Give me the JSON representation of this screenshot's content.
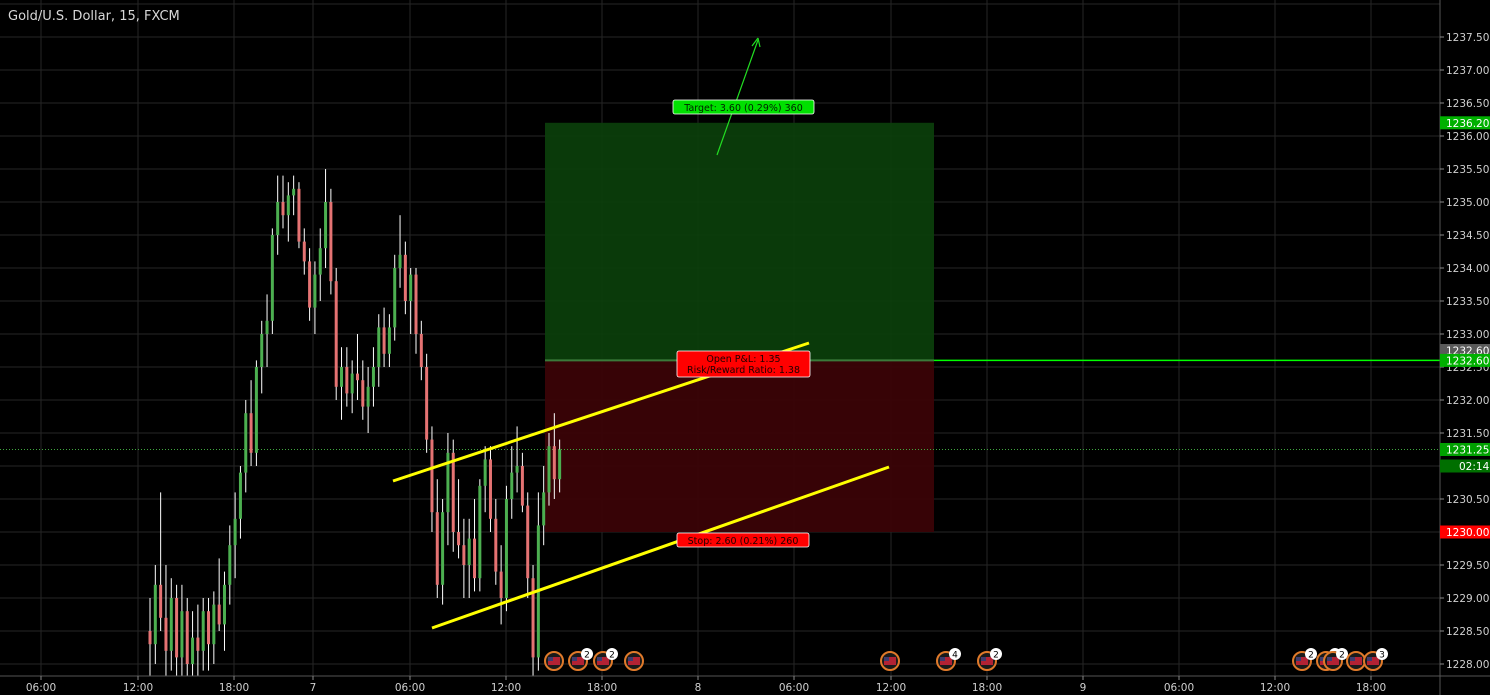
{
  "header": {
    "title": "Gold/U.S. Dollar, 15, FXCM"
  },
  "colors": {
    "background": "#000000",
    "grid": "#262626",
    "up_candle": "#4caf50",
    "down_candle": "#e57373",
    "wick": "#ffffff",
    "channel_line": "#ffff00",
    "target_zone": "#0b3d0b",
    "stop_zone": "#3a0306",
    "entry_line": "#00ff00",
    "target_label": "#00e000",
    "stop_label": "#ff0000",
    "price_tag_current": "#00a000",
    "price_tag_last": "#5a5a5a"
  },
  "chart_data": {
    "type": "candlestick",
    "symbol": "Gold/U.S. Dollar",
    "interval": "15",
    "source": "FXCM",
    "ylim": [
      1227.8,
      1238.2
    ],
    "y_ticks": [
      "1228.00",
      "1228.50",
      "1229.00",
      "1229.50",
      "1230.50",
      "1231.00",
      "1231.50",
      "1232.00",
      "1232.50",
      "1233.00",
      "1233.50",
      "1234.00",
      "1234.50",
      "1235.00",
      "1235.50",
      "1236.00",
      "1236.50",
      "1237.00",
      "1237.50"
    ],
    "x_ticks": [
      "06:00",
      "12:00",
      "18:00",
      "7",
      "06:00",
      "12:00",
      "18:00",
      "8",
      "06:00",
      "12:00",
      "18:00",
      "9",
      "06:00",
      "12:00",
      "18:00"
    ],
    "price_tags": [
      {
        "label": "1236.20",
        "value": 1236.2,
        "kind": "target"
      },
      {
        "label": "1232.60",
        "value": 1232.75,
        "kind": "last"
      },
      {
        "label": "1232.60",
        "value": 1232.6,
        "kind": "entry"
      },
      {
        "label": "1231.25",
        "value": 1231.25,
        "kind": "current"
      },
      {
        "label": "02:14",
        "value": 1231.0,
        "kind": "countdown"
      },
      {
        "label": "1230.00",
        "value": 1230.0,
        "kind": "stop"
      }
    ],
    "position": {
      "entry": 1232.6,
      "target": 1236.2,
      "stop": 1230.0,
      "target_label": "Target: 3.60 (0.29%) 360",
      "stop_label": "Stop: 2.60 (0.21%) 260",
      "pnl_label_line1": "Open P&L: 1.35",
      "pnl_label_line2": "Risk/Reward Ratio: 1.38"
    },
    "candles": [
      [
        1228.5,
        1229.0,
        1227.8,
        1228.3
      ],
      [
        1228.3,
        1229.5,
        1228.0,
        1229.2
      ],
      [
        1229.2,
        1230.6,
        1228.5,
        1228.7
      ],
      [
        1228.7,
        1229.5,
        1227.8,
        1228.2
      ],
      [
        1228.2,
        1229.3,
        1227.9,
        1229.0
      ],
      [
        1229.0,
        1229.2,
        1227.8,
        1228.1
      ],
      [
        1228.1,
        1229.2,
        1227.8,
        1228.8
      ],
      [
        1228.8,
        1229.0,
        1227.8,
        1228.0
      ],
      [
        1228.0,
        1228.8,
        1227.8,
        1228.4
      ],
      [
        1228.4,
        1228.9,
        1227.8,
        1228.2
      ],
      [
        1228.2,
        1229.0,
        1227.9,
        1228.8
      ],
      [
        1228.8,
        1229.0,
        1227.9,
        1228.3
      ],
      [
        1228.3,
        1229.1,
        1228.0,
        1228.9
      ],
      [
        1228.9,
        1229.6,
        1228.5,
        1228.6
      ],
      [
        1228.6,
        1229.4,
        1228.2,
        1229.2
      ],
      [
        1229.2,
        1230.1,
        1228.9,
        1229.8
      ],
      [
        1229.8,
        1230.6,
        1229.3,
        1230.2
      ],
      [
        1230.2,
        1231.0,
        1229.9,
        1230.9
      ],
      [
        1230.9,
        1232.0,
        1230.6,
        1231.8
      ],
      [
        1231.8,
        1232.3,
        1231.0,
        1231.2
      ],
      [
        1231.2,
        1232.6,
        1231.0,
        1232.5
      ],
      [
        1232.5,
        1233.2,
        1232.1,
        1233.0
      ],
      [
        1233.0,
        1233.6,
        1232.5,
        1233.2
      ],
      [
        1233.2,
        1234.6,
        1233.0,
        1234.5
      ],
      [
        1234.5,
        1235.4,
        1234.2,
        1235.0
      ],
      [
        1235.0,
        1235.4,
        1234.6,
        1234.8
      ],
      [
        1234.8,
        1235.3,
        1234.4,
        1235.1
      ],
      [
        1235.1,
        1235.4,
        1234.8,
        1235.2
      ],
      [
        1235.2,
        1235.3,
        1234.3,
        1234.4
      ],
      [
        1234.4,
        1234.6,
        1233.9,
        1234.1
      ],
      [
        1234.1,
        1234.3,
        1233.2,
        1233.4
      ],
      [
        1233.4,
        1234.1,
        1233.0,
        1233.9
      ],
      [
        1233.9,
        1234.6,
        1233.5,
        1234.3
      ],
      [
        1234.3,
        1235.5,
        1234.0,
        1235.0
      ],
      [
        1235.0,
        1235.2,
        1233.6,
        1233.8
      ],
      [
        1233.8,
        1234.0,
        1232.0,
        1232.2
      ],
      [
        1232.2,
        1232.8,
        1231.7,
        1232.5
      ],
      [
        1232.5,
        1232.8,
        1231.9,
        1232.1
      ],
      [
        1232.1,
        1232.6,
        1231.8,
        1232.4
      ],
      [
        1232.4,
        1233.0,
        1232.0,
        1232.3
      ],
      [
        1232.3,
        1232.6,
        1231.7,
        1231.9
      ],
      [
        1231.9,
        1232.5,
        1231.5,
        1232.2
      ],
      [
        1232.2,
        1232.8,
        1231.9,
        1232.5
      ],
      [
        1232.5,
        1233.3,
        1232.2,
        1233.1
      ],
      [
        1233.1,
        1233.4,
        1232.5,
        1232.7
      ],
      [
        1232.7,
        1233.3,
        1232.5,
        1233.1
      ],
      [
        1233.1,
        1234.2,
        1232.9,
        1234.0
      ],
      [
        1234.0,
        1234.8,
        1233.7,
        1234.2
      ],
      [
        1234.2,
        1234.4,
        1233.3,
        1233.5
      ],
      [
        1233.5,
        1234.0,
        1233.0,
        1233.9
      ],
      [
        1233.9,
        1234.0,
        1232.7,
        1233.0
      ],
      [
        1233.0,
        1233.2,
        1232.3,
        1232.5
      ],
      [
        1232.5,
        1232.7,
        1231.2,
        1231.4
      ],
      [
        1231.4,
        1231.6,
        1230.0,
        1230.3
      ],
      [
        1230.3,
        1230.8,
        1229.0,
        1229.2
      ],
      [
        1229.2,
        1230.5,
        1228.9,
        1230.3
      ],
      [
        1230.3,
        1231.5,
        1229.8,
        1231.2
      ],
      [
        1231.2,
        1231.4,
        1229.7,
        1230.0
      ],
      [
        1230.0,
        1230.8,
        1229.6,
        1229.8
      ],
      [
        1229.8,
        1230.2,
        1229.0,
        1229.5
      ],
      [
        1229.5,
        1230.2,
        1229.0,
        1229.9
      ],
      [
        1229.9,
        1230.5,
        1229.1,
        1229.3
      ],
      [
        1229.3,
        1230.8,
        1229.1,
        1230.7
      ],
      [
        1230.7,
        1231.3,
        1230.3,
        1231.1
      ],
      [
        1231.1,
        1231.3,
        1230.0,
        1230.2
      ],
      [
        1230.2,
        1230.5,
        1229.2,
        1229.4
      ],
      [
        1229.4,
        1229.8,
        1228.6,
        1229.0
      ],
      [
        1229.0,
        1230.7,
        1228.8,
        1230.5
      ],
      [
        1230.5,
        1231.3,
        1230.2,
        1230.9
      ],
      [
        1230.9,
        1231.6,
        1230.6,
        1231.0
      ],
      [
        1231.0,
        1231.2,
        1230.3,
        1230.4
      ],
      [
        1230.4,
        1230.6,
        1229.0,
        1229.3
      ],
      [
        1229.3,
        1229.5,
        1227.8,
        1228.1
      ],
      [
        1228.1,
        1230.6,
        1227.9,
        1230.1
      ],
      [
        1230.1,
        1231.0,
        1229.8,
        1230.6
      ],
      [
        1230.6,
        1231.5,
        1230.4,
        1231.3
      ],
      [
        1231.3,
        1231.8,
        1230.5,
        1230.8
      ],
      [
        1230.8,
        1231.4,
        1230.6,
        1231.25
      ]
    ]
  },
  "events": [
    {
      "x_pos": "first",
      "badge": ""
    },
    {
      "x_pos": "second",
      "badge": "2"
    },
    {
      "x_pos": "third",
      "badge": "2"
    },
    {
      "x_pos": "fourth",
      "badge": ""
    },
    {
      "x_pos": "fifth",
      "badge": ""
    },
    {
      "x_pos": "sixth",
      "badge": "4"
    },
    {
      "x_pos": "seventh",
      "badge": "2"
    },
    {
      "x_pos": "eighth",
      "badge": "2"
    },
    {
      "x_pos": "ninth",
      "badge": "2"
    },
    {
      "x_pos": "tenth",
      "badge": "2"
    },
    {
      "x_pos": "eleventh",
      "badge": ""
    },
    {
      "x_pos": "twelfth",
      "badge": "3"
    }
  ]
}
